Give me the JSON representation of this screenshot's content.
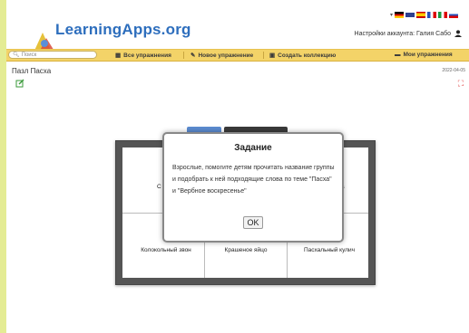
{
  "header": {
    "logo_text": "LearningApps.org",
    "account_label": "Настройки аккаунта: Галия Сабо",
    "flags": [
      "de",
      "en",
      "es",
      "fr",
      "it",
      "ru"
    ]
  },
  "navbar": {
    "search_placeholder": "Поиск",
    "all_exercises": "Все упражнения",
    "new_exercise": "Новое упражнение",
    "create_collection": "Создать коллекцию",
    "my_exercises": "Мои упражнения"
  },
  "page": {
    "title": "Пазл Пасха",
    "date": "2022-04-05"
  },
  "puzzle": {
    "pieces_top_left": "С",
    "pieces_top_right": "ка",
    "piece_bell": "Колокольный звон",
    "piece_egg": "Крашеное яйцо",
    "piece_kulich": "Пасхальный кулич"
  },
  "dialog": {
    "title": "Задание",
    "text": "Взрослые, помогите детям прочитать название группы и подобрать к ней подходящие слова по теме \"Пасха\" и \"Вербное воскресенье\"",
    "ok_label": "OK"
  }
}
